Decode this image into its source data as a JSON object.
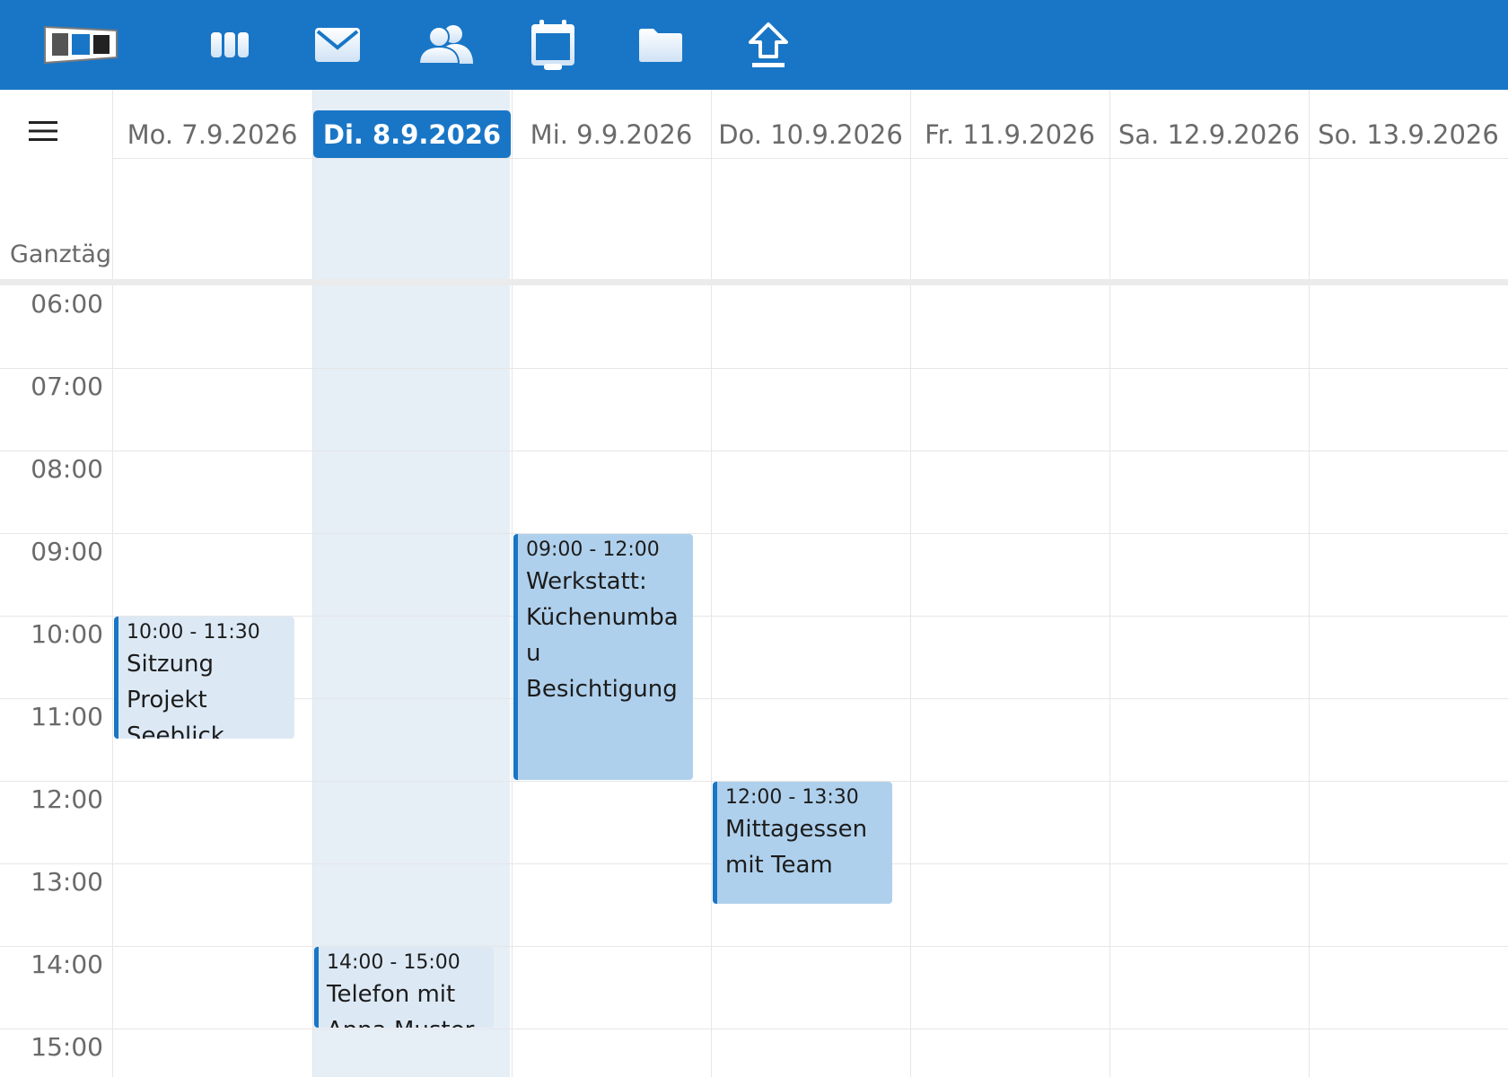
{
  "toolbar": {
    "logo_icon": "app-logo",
    "items": [
      {
        "name": "apps",
        "icon": "grid-columns-icon"
      },
      {
        "name": "mail",
        "icon": "mail-icon"
      },
      {
        "name": "contacts",
        "icon": "contacts-icon"
      },
      {
        "name": "calendar",
        "icon": "calendar-icon"
      },
      {
        "name": "files",
        "icon": "folder-icon"
      },
      {
        "name": "upload",
        "icon": "upload-icon"
      }
    ],
    "color": "#1976c6"
  },
  "calendar": {
    "menu_icon": "hamburger-menu-icon",
    "allday_label": "Ganztägig",
    "days": [
      {
        "label": "Mo. 7.9.2026",
        "today": false
      },
      {
        "label": "Di. 8.9.2026",
        "today": true
      },
      {
        "label": "Mi. 9.9.2026",
        "today": false
      },
      {
        "label": "Do. 10.9.2026",
        "today": false
      },
      {
        "label": "Fr. 11.9.2026",
        "today": false
      },
      {
        "label": "Sa. 12.9.2026",
        "today": false
      },
      {
        "label": "So. 13.9.2026",
        "today": false
      }
    ],
    "hours": [
      "06:00",
      "07:00",
      "08:00",
      "09:00",
      "10:00",
      "11:00",
      "12:00",
      "13:00",
      "14:00",
      "15:00"
    ],
    "events": [
      {
        "time": "10:00 - 11:30",
        "title": "Sitzung Projekt Seeblick",
        "day": "Mo. 7.9.2026",
        "start": "10:00",
        "end": "11:30"
      },
      {
        "time": "09:00 - 12:00",
        "title": "Werkstatt: Küchenumbau Besichtigung",
        "day": "Mi. 9.9.2026",
        "start": "09:00",
        "end": "12:00"
      },
      {
        "time": "12:00 - 13:30",
        "title": "Mittagessen mit Team",
        "day": "Do. 10.9.2026",
        "start": "12:00",
        "end": "13:30"
      },
      {
        "time": "14:00 - 15:00",
        "title": "Telefon mit Anna Muster",
        "day": "Di. 8.9.2026",
        "start": "14:00",
        "end": "15:00"
      }
    ],
    "colors": {
      "accent": "#1976c6",
      "today_column": "#e6eef6",
      "event_light": "#dce9f5",
      "event_mid": "#afd0ec"
    }
  }
}
